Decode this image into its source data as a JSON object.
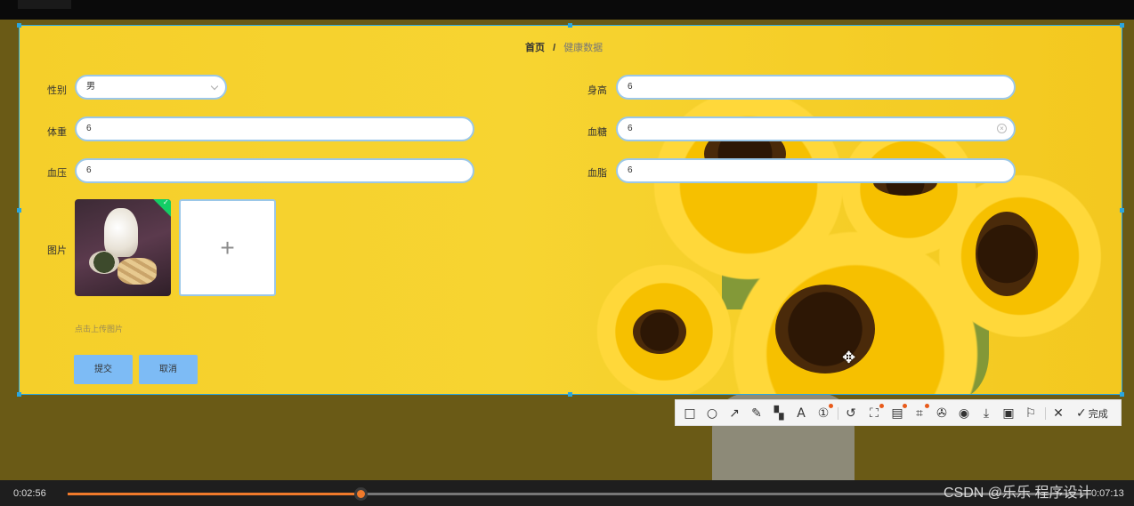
{
  "breadcrumb": {
    "home": "首页",
    "separator": "/",
    "current": "健康数据"
  },
  "form": {
    "gender": {
      "label": "性别",
      "value": "男"
    },
    "height": {
      "label": "身高",
      "value": "6"
    },
    "weight": {
      "label": "体重",
      "value": "6"
    },
    "blood_sugar": {
      "label": "血糖",
      "value": "6"
    },
    "blood_pressure": {
      "label": "血压",
      "value": "6"
    },
    "blood_lipid": {
      "label": "血脂",
      "value": "6"
    },
    "image": {
      "label": "图片",
      "hint": "点击上传图片"
    },
    "submit_label": "提交",
    "cancel_label": "取消"
  },
  "screenshot_toolbar": {
    "tools": [
      "rectangle-icon",
      "ellipse-icon",
      "arrow-icon",
      "pencil-icon",
      "mosaic-icon",
      "text-icon",
      "number-icon",
      "undo-icon",
      "mosaic-ai-icon",
      "ocr-icon",
      "scan-icon",
      "pin-icon",
      "record-icon",
      "download-icon",
      "save-icon",
      "bookmark-icon",
      "close-icon"
    ],
    "done_label": "完成"
  },
  "player": {
    "current_time": "0:02:56",
    "total_time": "0:07:13",
    "progress": 0.287
  },
  "watermark": "CSDN @乐乐 程序设计",
  "colors": {
    "accent": "#f07a2b",
    "field_border": "#9bc7e8",
    "button": "#7dbbf5",
    "selection": "#2aa6e0"
  }
}
